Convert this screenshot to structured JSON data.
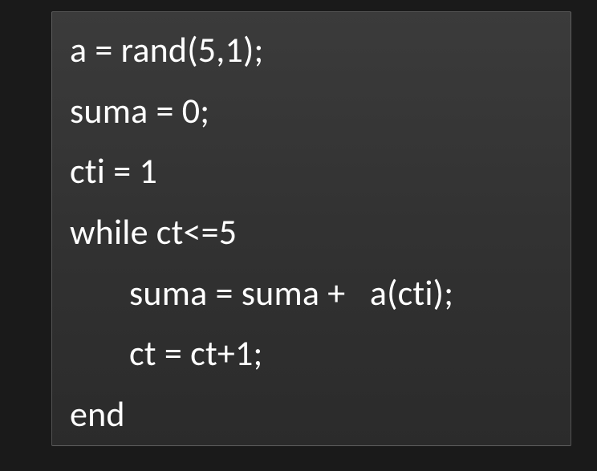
{
  "code": {
    "line1": "a = rand(5,1);",
    "line2": "suma = 0;",
    "line3": "cti = 1",
    "line4": "while ct<=5",
    "line5": "suma = suma +   a(cti);",
    "line6": "ct = ct+1;",
    "line7": "end"
  }
}
